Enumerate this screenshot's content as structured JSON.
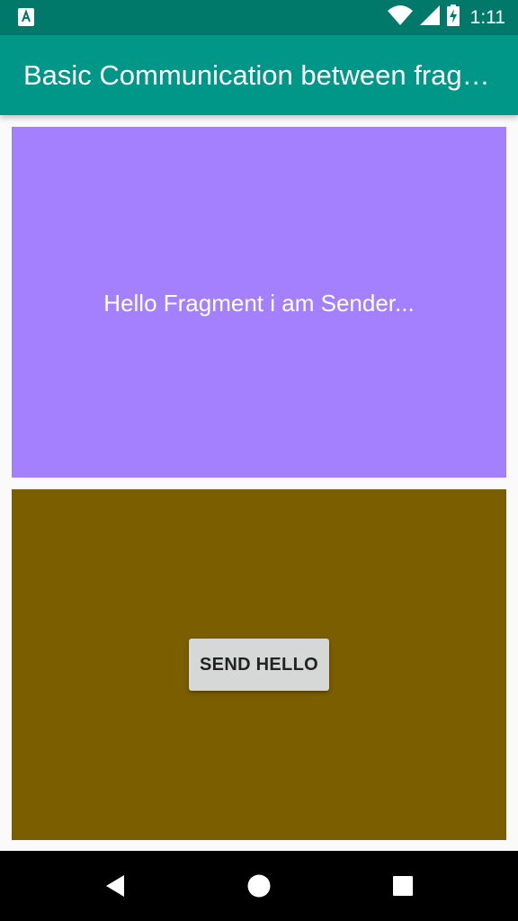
{
  "status_bar": {
    "time": "1:11",
    "icons": [
      "notification-a-icon",
      "wifi-icon",
      "cell-signal-icon",
      "battery-charging-icon"
    ]
  },
  "app_bar": {
    "title": "Basic Communication between fragments"
  },
  "sender_fragment": {
    "message": "Hello Fragment i am Sender...",
    "background": "#a47ffe"
  },
  "receiver_fragment": {
    "button_label": "SEND HELLO",
    "background": "#7b5e00"
  },
  "nav_bar": {
    "buttons": [
      "back-icon",
      "home-icon",
      "recents-icon"
    ]
  },
  "colors": {
    "status_bar": "#00796b",
    "app_bar": "#009688"
  }
}
